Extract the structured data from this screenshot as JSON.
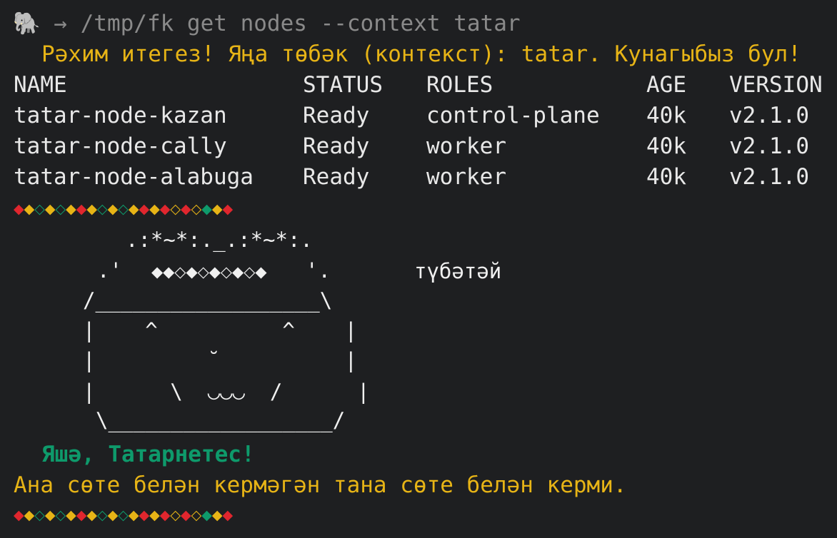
{
  "prompt": {
    "icon": "🐘",
    "arrow": "→",
    "command": "/tmp/fk get nodes --context tatar"
  },
  "welcome": "Рәхим итегез! Яңа төбәк (контекст): tatar. Кунагыбыз бул!",
  "table": {
    "headers": {
      "name": "NAME",
      "status": "STATUS",
      "roles": "ROLES",
      "age": "AGE",
      "version": "VERSION"
    },
    "rows": [
      {
        "name": "tatar-node-kazan",
        "status": "Ready",
        "roles": "control-plane",
        "age": "40k",
        "version": "v2.1.0"
      },
      {
        "name": "tatar-node-cally",
        "status": "Ready",
        "roles": "worker",
        "age": "40k",
        "version": "v2.1.0"
      },
      {
        "name": "tatar-node-alabuga",
        "status": "Ready",
        "roles": "worker",
        "age": "40k",
        "version": "v2.1.0"
      }
    ]
  },
  "divider": {
    "pattern": [
      "red",
      "yel",
      "grn",
      "yel",
      "grn",
      "yel",
      "red",
      "yel",
      "grn",
      "yel",
      "grn",
      "yel",
      "red",
      "yel",
      "red",
      "yel",
      "red",
      "yel",
      "grn",
      "yel",
      "red"
    ],
    "filled": [
      true,
      true,
      false,
      true,
      false,
      true,
      true,
      true,
      false,
      true,
      false,
      true,
      true,
      true,
      true,
      false,
      true,
      false,
      true,
      true,
      true
    ],
    "glyph_filled": "◆",
    "glyph_hollow": "◇",
    "colors": {
      "red": "#e0262e",
      "yel": "#e7b416",
      "grn": "#0e9a6b"
    }
  },
  "art": {
    "line1": ".:*~*:._.:*~*:.",
    "line2_left": ".'",
    "line2_pattern": "◆◆◇◆◇◆◇◆◇◆",
    "line2_right": "'.",
    "line3": "/__________________\\",
    "line4": "|    ^          ^    |",
    "line5": "|         ˘          |",
    "line6": "|      \\  ◡◡◡  /      |",
    "line7": "\\__________________/",
    "label": "түбәтәй"
  },
  "slogan": "Яшә, Татарнетес!",
  "proverb": "Ана сөте белән кермәгән тана сөте белән керми.",
  "colors": {
    "background": "#1e1f21",
    "prompt": "#8a8a8a",
    "welcome": "#e7b416",
    "slogan": "#0e9a6b",
    "proverb": "#e7b416",
    "text": "#e8e8e8"
  }
}
